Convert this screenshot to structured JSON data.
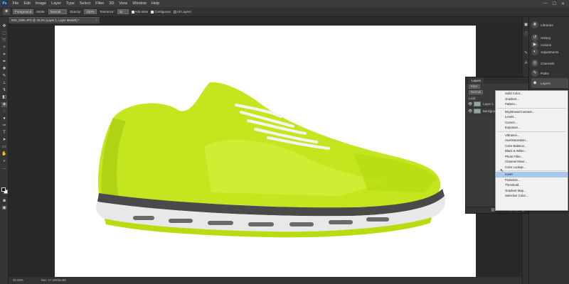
{
  "menubar": {
    "logo": "Ps",
    "items": [
      "File",
      "Edit",
      "Image",
      "Layer",
      "Type",
      "Select",
      "Filter",
      "3D",
      "View",
      "Window",
      "Help"
    ],
    "controls": [
      "—",
      "☐",
      "✕"
    ]
  },
  "options": {
    "brush_preset": "Foreground",
    "mode_label": "Mode:",
    "mode_value": "Normal",
    "opacity_label": "Opacity:",
    "opacity_value": "100%",
    "tolerance_label": "Tolerance:",
    "tolerance_value": "32",
    "antialias_label": "Anti-alias",
    "contiguous_label": "Contiguous",
    "all_layers_label": "All Layers"
  },
  "document": {
    "tab_title": "IMG_9495.JPG @ 33.3% (Layer 1, Layer Mask/8) *",
    "close": "×"
  },
  "statusbar": {
    "zoom": "33.33%",
    "doc_size": "Doc: 17.1M/35.4M"
  },
  "panels": {
    "items": [
      {
        "label": "Libraries",
        "icon": "❖"
      },
      {
        "label": "History",
        "icon": "↺"
      },
      {
        "label": "Actions",
        "icon": "▶"
      },
      {
        "label": "Adjustments",
        "icon": "◐"
      },
      {
        "label": "Channels",
        "icon": "◎"
      },
      {
        "label": "Paths",
        "icon": "✎"
      },
      {
        "label": "Layers",
        "icon": "◆"
      }
    ]
  },
  "layers_panel": {
    "tab": "Layers",
    "kind_label": "Kind",
    "blend_mode": "Normal",
    "lock_label": "Lock:",
    "layers": [
      {
        "name": "Layer 1"
      },
      {
        "name": "Background"
      }
    ],
    "bottom_icons": [
      "⛓",
      "fx",
      "◐",
      "▣",
      "▤",
      "🗑"
    ]
  },
  "adjustment_menu": {
    "items": [
      "Solid Color...",
      "Gradient...",
      "Pattern...",
      "---",
      "Brightness/Contrast...",
      "Levels...",
      "Curves...",
      "Exposure...",
      "---",
      "Vibrance...",
      "Hue/Saturation...",
      "Color Balance...",
      "Black & White...",
      "Photo Filter...",
      "Channel Mixer...",
      "Color Lookup...",
      "---",
      "Invert",
      "Posterize...",
      "Threshold...",
      "Gradient Map...",
      "Selective Color..."
    ],
    "highlighted": "Invert"
  },
  "colors": {
    "shoe_upper": "#c4e61e",
    "shoe_sole": "#e8e8e8",
    "menu_highlight": "#a9c9ea"
  }
}
